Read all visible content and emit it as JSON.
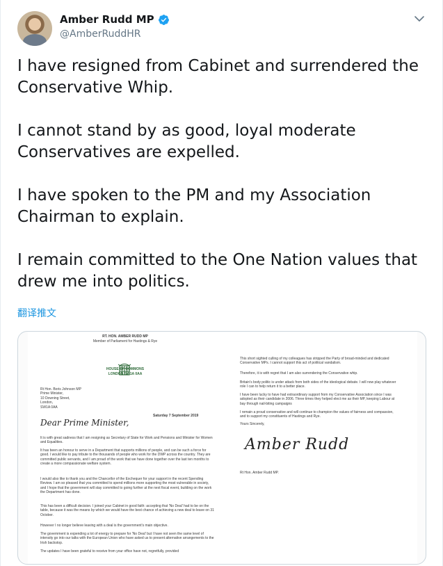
{
  "author": {
    "name": "Amber Rudd MP",
    "handle": "@AmberRuddHR",
    "verified": true
  },
  "tweet": {
    "text": "I have resigned from Cabinet and surrendered the Conservative Whip.\n\nI cannot stand by as good, loyal moderate Conservatives are expelled.\n\nI have spoken to the PM and my Association Chairman to explain.\n\nI remain committed to the One Nation values that drew me into politics.",
    "translate_label": "翻译推文"
  },
  "icons": {
    "verified": "verified-badge-icon",
    "menu": "chevron-down-icon"
  },
  "colors": {
    "link": "#1b95e0",
    "verified": "#1da1f2",
    "hoc_green": "#2f6b3a"
  },
  "letter": {
    "header_name": "RT. HON. AMBER RUDD MP",
    "header_role": "Member of Parliament for Hastings & Rye",
    "hoc_line1": "HOUSE OF COMMONS",
    "hoc_line2": "LONDON SW1A 0AA",
    "addressee": "Rt Hon. Boris Johnson MP\nPrime Minister,\n10 Downing Street,\nLondon,\nSW1A 0AA",
    "date": "Saturday 7 September 2019",
    "salutation": "Dear Prime Minister,",
    "para1": "It is with great sadness that I am resigning as Secretary of State for Work and Pensions and Minister for Women and Equalities.",
    "para2": "It has been an honour to serve in a Department that supports millions of people, and can be such a force for good. I would like to pay tribute to the thousands of people who work for the DWP across the country. They are committed public servants, and I am proud of the work that we have done together over the last ten months to create a more compassionate welfare system.",
    "para3": "I would also like to thank you and the Chancellor of the Exchequer for your support in the recent Spending Review. I am so pleased that you committed to spend millions more supporting the most vulnerable in society, and I hope that the government will stay committed to going further at the next fiscal event, building on the work the Department has done.",
    "para4": "This has been a difficult decision. I joined your Cabinet in good faith: accepting that 'No Deal' had to be on the table, because it was the means by which we would have the best chance of achieving a new deal to leave on 31 October.",
    "para5": "However I no longer believe leaving with a deal is the government's main objective.",
    "para6": "The government is expending a lot of energy to prepare for 'No Deal' but I have not seen the same level of intensity go into our talks with the European Union who have asked us to present alternative arrangements to the Irish backstop.",
    "para7": "The updates I have been grateful to receive from your office have not, regretfully, provided",
    "right1": "This short sighted culling of my colleagues has stripped the Party of broad-minded and dedicated Conservative MPs. I cannot support this act of political vandalism.",
    "right2": "Therefore, it is with regret that I am also surrendering the Conservative whip.",
    "right3": "Britain's body politic is under attack from both sides of the ideological debate. I will now play whatever role I can to help return it to a better place.",
    "right4": "I have been lucky to have had extraordinary support from my Conservative Association since I was adopted as their candidate in 2006. Three times they helped elect me as their MP, keeping Labour at bay through nail-biting campaigns",
    "right5": "I remain a proud conservative and will continue to champion the values of fairness and compassion, and to support my constituents of Hastings and Rye.",
    "signoff": "Yours Sincerely,",
    "signature": "Amber Rudd",
    "signed_name": "Rt Hon. Amber Rudd MP."
  }
}
